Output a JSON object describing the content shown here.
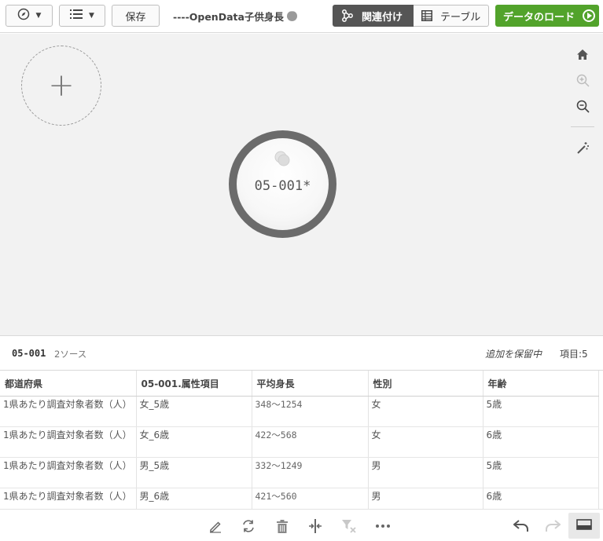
{
  "toolbar": {
    "save_label": "保存",
    "app_title": "----OpenData子供身長",
    "associations_label": "関連付け",
    "tables_label": "テーブル",
    "load_data_label": "データのロード"
  },
  "canvas": {
    "table_node_label": "05-001*"
  },
  "preview": {
    "table_name": "05-001",
    "source_count": "2ソース",
    "status": "追加を保留中",
    "fields_count": "項目:5",
    "columns": [
      "都道府県",
      "05-001.属性項目",
      "平均身長",
      "性別",
      "年齢"
    ],
    "rows": [
      [
        "1県あたり調査対象者数（人）",
        "女_5歳",
        "348〜1254",
        "女",
        "5歳"
      ],
      [
        "1県あたり調査対象者数（人）",
        "女_6歳",
        "422〜568",
        "女",
        "6歳"
      ],
      [
        "1県あたり調査対象者数（人）",
        "男_5歳",
        "332〜1249",
        "男",
        "5歳"
      ],
      [
        "1県あたり調査対象者数（人）",
        "男_6歳",
        "421〜560",
        "男",
        "6歳"
      ]
    ]
  },
  "icons": {
    "compass": "compass-icon",
    "list": "list-icon",
    "home": "home-icon",
    "zoom_in": "zoom-in-icon",
    "zoom_out": "zoom-out-icon",
    "wand": "magic-wand-icon",
    "edit": "pencil-icon",
    "refresh": "refresh-icon",
    "delete": "trash-icon",
    "split": "split-icon",
    "filter": "filter-icon",
    "more": "more-icon",
    "undo": "undo-icon",
    "redo": "redo-icon",
    "panel": "panel-icon"
  },
  "colors": {
    "accent_green": "#52a32b",
    "active_segment": "#555555",
    "canvas_bg": "#f2f2f2"
  }
}
